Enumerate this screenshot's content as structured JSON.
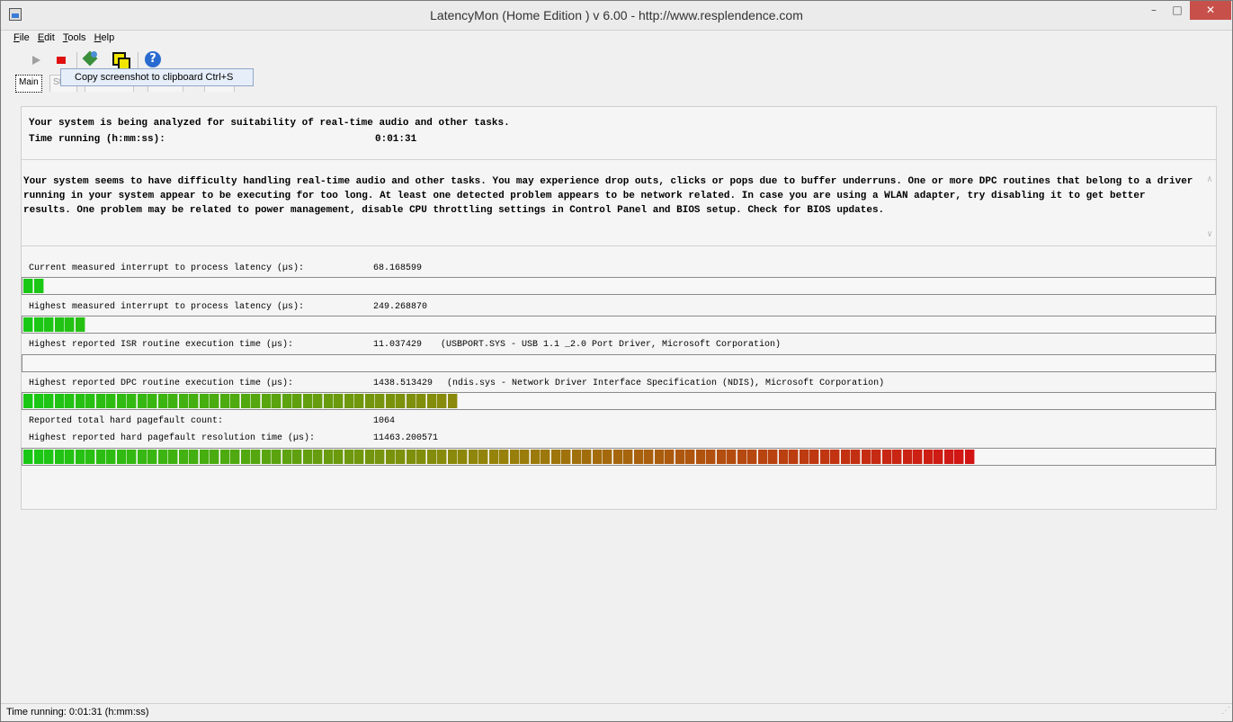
{
  "window": {
    "title": "LatencyMon  (Home Edition )  v 6.00 - http://www.resplendence.com",
    "minimize": "–",
    "maximize": "□",
    "close": "✕"
  },
  "menu": [
    "File",
    "Edit",
    "Tools",
    "Help"
  ],
  "toolbar": {
    "icons": [
      "play-icon",
      "stop-icon",
      "report-icon",
      "copy-screenshot-icon",
      "about-icon"
    ],
    "tooltip": "Copy screenshot to clipboard Ctrl+S"
  },
  "tabs": [
    "Main",
    "Stats",
    "Processes",
    "Drivers",
    "CPUs"
  ],
  "main": {
    "intro": "Your system is being analyzed for suitability of real-time audio and other tasks.",
    "time_label": "Time running (h:mm:ss):",
    "time_value": "0:01:31",
    "advice": "Your system seems to have difficulty handling real-time audio and other tasks. You may experience drop outs, clicks or pops due to buffer underruns. One or more DPC routines that belong to a driver running in your system appear to be executing for too long. At least one detected problem appears to be network related. In case you are using a WLAN adapter, try disabling it to get better results. One problem may be related to power management, disable CPU throttling settings in Control Panel and BIOS setup. Check for BIOS updates."
  },
  "metrics": [
    {
      "label": "Current measured interrupt to process latency (µs):",
      "value": "68.168599",
      "detail": "",
      "segments": 2
    },
    {
      "label": "Highest measured interrupt to process latency (µs):",
      "value": "249.268870",
      "detail": "",
      "segments": 6
    },
    {
      "label": "Highest reported ISR routine execution time (µs):",
      "value": "11.037429",
      "detail": "(USBPORT.SYS - USB 1.1 _2.0 Port Driver, Microsoft Corporation)",
      "segments": 0
    },
    {
      "label": "Highest reported DPC routine execution time (µs):",
      "value": "1438.513429",
      "detail": "(ndis.sys - Network Driver Interface Specification (NDIS), Microsoft Corporation)",
      "segments": 42
    }
  ],
  "pagefault": {
    "count_label": "Reported total hard pagefault count:",
    "count_value": "1064",
    "time_label": "Highest reported hard pagefault resolution time (µs):",
    "time_value": "11463.200571",
    "segments": 92
  },
  "status": {
    "text": "Time running: 0:01:31  (h:mm:ss)"
  },
  "colors": {
    "meter_low": "#18c814",
    "meter_high": "#d21414"
  }
}
